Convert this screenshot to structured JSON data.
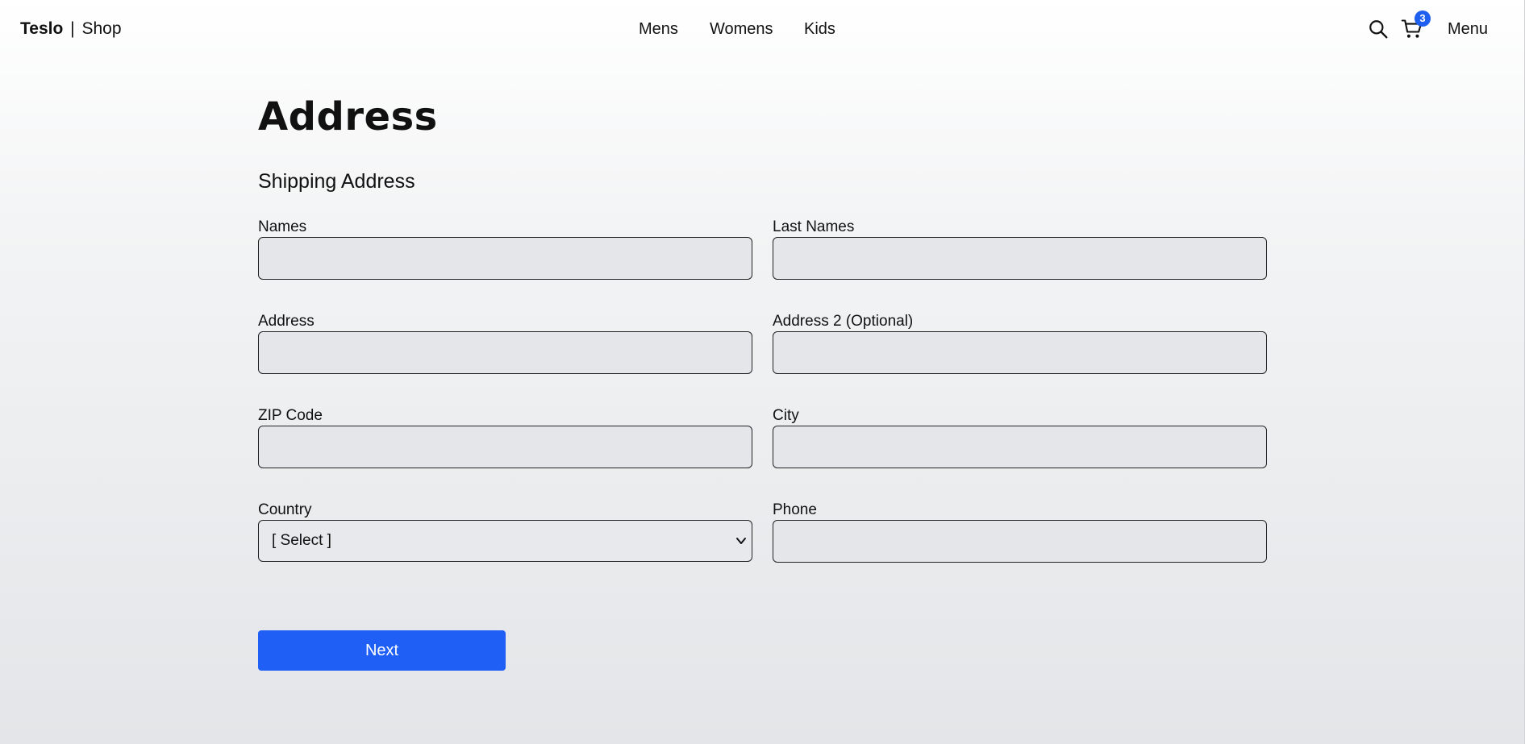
{
  "header": {
    "brand_name": "Teslo",
    "brand_separator": "|",
    "brand_suffix": "Shop",
    "nav": [
      "Mens",
      "Womens",
      "Kids"
    ],
    "search_icon": "search-icon",
    "cart_icon": "cart-icon",
    "cart_count": "3",
    "menu_label": "Menu"
  },
  "page": {
    "title": "Address",
    "subtitle": "Shipping Address"
  },
  "form": {
    "names_label": "Names",
    "names_value": "",
    "last_names_label": "Last Names",
    "last_names_value": "",
    "address_label": "Address",
    "address_value": "",
    "address2_label": "Address 2 (Optional)",
    "address2_value": "",
    "zip_label": "ZIP Code",
    "zip_value": "",
    "city_label": "City",
    "city_value": "",
    "country_label": "Country",
    "country_selected": "[ Select ]",
    "phone_label": "Phone",
    "phone_value": ""
  },
  "actions": {
    "next_label": "Next"
  },
  "colors": {
    "accent": "#1f5ff6",
    "badge": "#1f5ff0",
    "input_bg": "#e5e6e9"
  }
}
